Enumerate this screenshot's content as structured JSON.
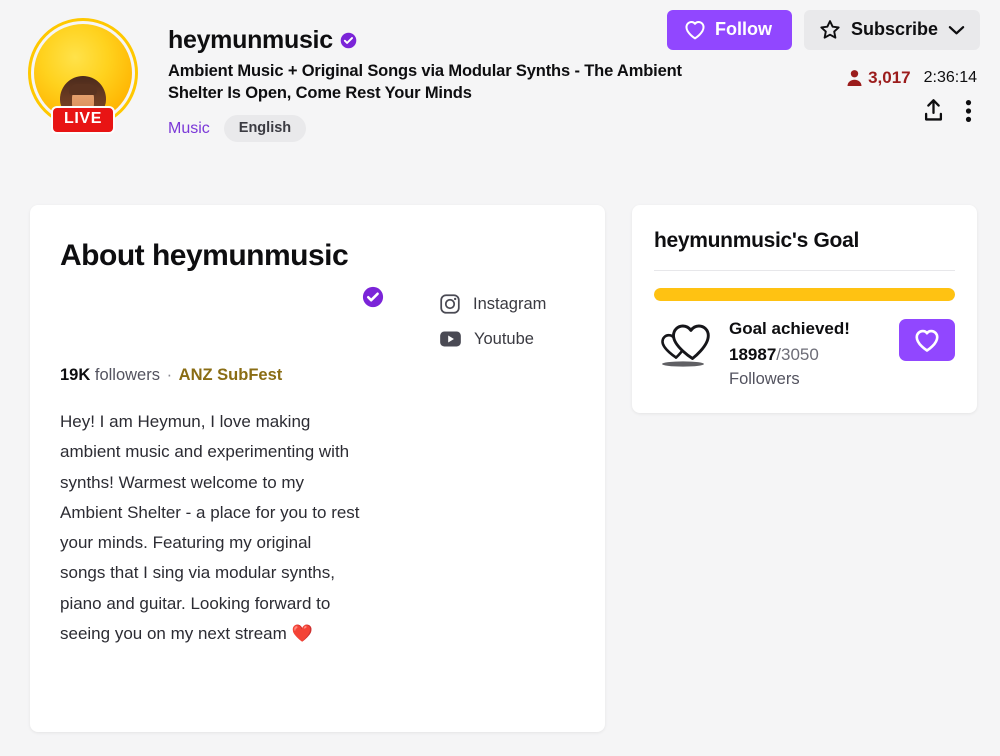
{
  "header": {
    "channel_name": "heymunmusic",
    "verified": true,
    "stream_title": "Ambient Music + Original Songs via Modular Synths - The Ambient Shelter Is Open, Come Rest Your Minds",
    "live_badge": "LIVE",
    "category": "Music",
    "tags": [
      "English"
    ],
    "follow_label": "Follow",
    "subscribe_label": "Subscribe",
    "viewer_count": "3,017",
    "uptime": "2:36:14",
    "icons": {
      "follow": "heart-icon",
      "subscribe": "star-icon",
      "subscribe_chevron": "chevron-down-icon",
      "viewers": "viewer-person-icon",
      "share": "share-upload-icon",
      "more": "more-vertical-icon",
      "verified": "verified-check-icon"
    },
    "colors": {
      "follow_bg": "#9147ff",
      "subscribe_bg": "#e9e9eb",
      "viewers_text": "#9b1c1c",
      "category_link": "#7b38d8",
      "live_bg": "#e81414",
      "avatar_ring": "#ffc800"
    }
  },
  "about": {
    "title": "About heymunmusic",
    "verified": true,
    "followers_count": "19K",
    "followers_label": "followers",
    "separator": "·",
    "badge_label": "ANZ SubFest",
    "bio": "Hey! I am Heymun, I love making ambient music and experimenting with synths! Warmest welcome to my Ambient Shelter - a place for you to rest your minds. Featuring my original songs that I sing via modular synths, piano and guitar. Looking forward to seeing you on my next stream ❤️",
    "socials": [
      {
        "label": "Instagram",
        "icon": "instagram-icon"
      },
      {
        "label": "Youtube",
        "icon": "youtube-icon"
      }
    ]
  },
  "goal": {
    "title": "heymunmusic's Goal",
    "status": "Goal achieved!",
    "current": "18987",
    "separator": "/",
    "target": "3050",
    "unit": "Followers",
    "progress_percent": 100,
    "bar_color": "#ffc212",
    "action_icon": "heart-icon",
    "goal_icon": "two-hearts-icon"
  }
}
